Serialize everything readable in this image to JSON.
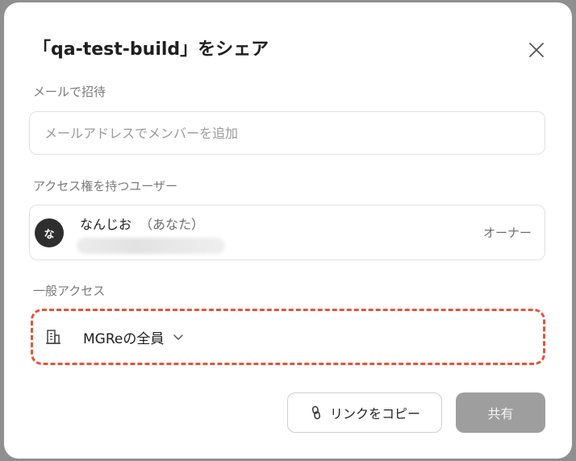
{
  "dialog": {
    "title": "「qa-test-build」をシェア",
    "close_icon": "close-icon"
  },
  "invite": {
    "label": "メールで招待",
    "placeholder": "メールアドレスでメンバーを追加",
    "value": ""
  },
  "users_with_access": {
    "label": "アクセス権を持つユーザー",
    "users": [
      {
        "avatar_text": "な",
        "name": "なんじお",
        "you_suffix": "（あなた）",
        "role": "オーナー"
      }
    ]
  },
  "general_access": {
    "label": "一般アクセス",
    "selected": "MGReの全員",
    "icon": "building-icon",
    "highlight_color": "#e2553b"
  },
  "actions": {
    "copy_link": "リンクをコピー",
    "share": "共有"
  }
}
